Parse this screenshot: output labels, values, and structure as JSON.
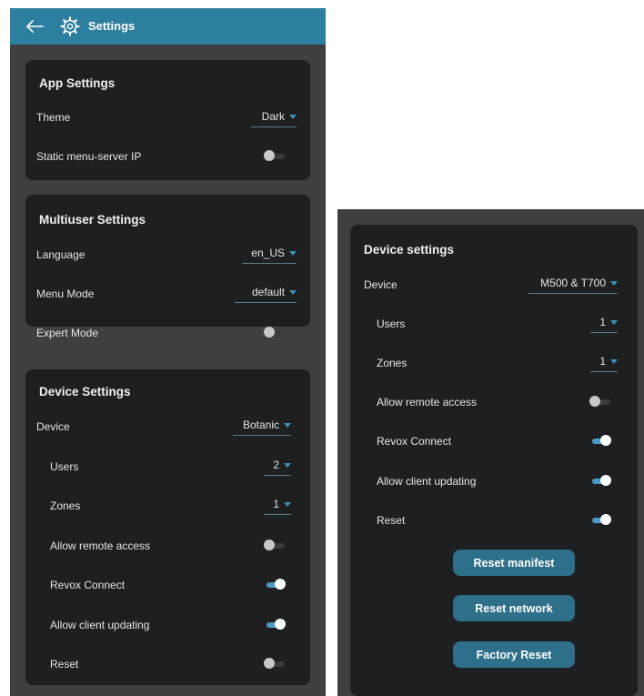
{
  "header": {
    "title": "Settings"
  },
  "app_settings": {
    "title": "App Settings",
    "theme_label": "Theme",
    "theme_value": "Dark",
    "static_ip_label": "Static menu-server IP",
    "static_ip_on": false
  },
  "multiuser_settings": {
    "title": "Multiuser Settings",
    "language_label": "Language",
    "language_value": "en_US",
    "menu_mode_label": "Menu Mode",
    "menu_mode_value": "default",
    "expert_mode_label": "Expert Mode",
    "expert_mode_on": false
  },
  "device_settings_left": {
    "title": "Device Settings",
    "device_label": "Device",
    "device_value": "Botanic",
    "users_label": "Users",
    "users_value": "2",
    "zones_label": "Zones",
    "zones_value": "1",
    "remote_label": "Allow remote access",
    "remote_on": false,
    "revox_label": "Revox Connect",
    "revox_on": true,
    "client_label": "Allow client updating",
    "client_on": true,
    "reset_label": "Reset",
    "reset_on": false
  },
  "device_settings_right": {
    "title": "Device settings",
    "device_label": "Device",
    "device_value": "M500 & T700",
    "users_label": "Users",
    "users_value": "1",
    "zones_label": "Zones",
    "zones_value": "1",
    "remote_label": "Allow remote access",
    "remote_on": false,
    "revox_label": "Revox Connect",
    "revox_on": true,
    "client_label": "Allow client updating",
    "client_on": true,
    "reset_label": "Reset",
    "reset_on": true,
    "reset_manifest_label": "Reset manifest",
    "reset_network_label": "Reset network",
    "factory_reset_label": "Factory Reset"
  },
  "colors": {
    "appbar": "#2d7fa0",
    "card": "#1e1f20",
    "toggle_on": "#4a9cc4",
    "button": "#2e6f8a"
  }
}
